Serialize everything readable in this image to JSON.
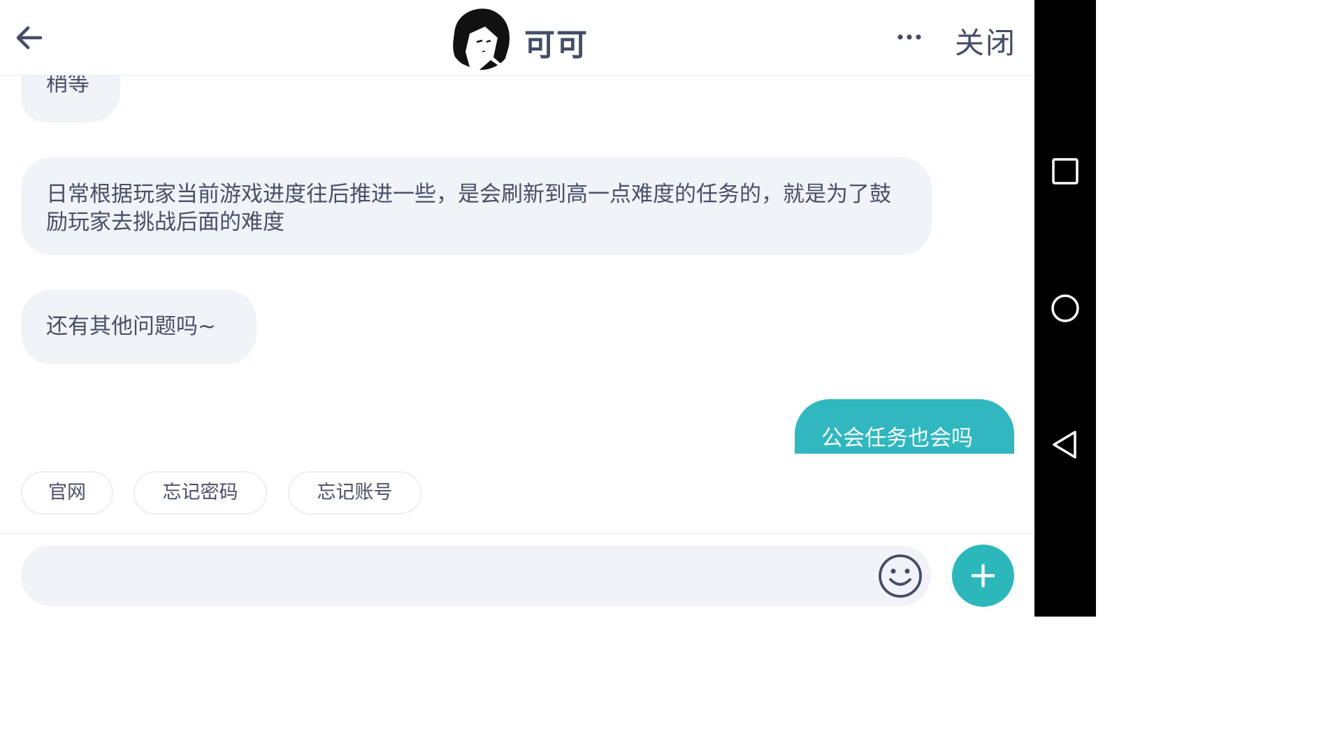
{
  "header": {
    "back_icon": "arrow-left-icon",
    "avatar_label": "anime-girl-avatar",
    "agent_name": "可可",
    "more_icon": "more-horizontal-icon",
    "close_label": "关闭"
  },
  "messages": [
    {
      "from": "agent",
      "text": "稍等"
    },
    {
      "from": "agent",
      "text": "日常根据玩家当前游戏进度往后推进一些，是会刷新到高一点难度的任务的，就是为了鼓励玩家去挑战后面的难度"
    },
    {
      "from": "agent",
      "text": "还有其他问题吗~"
    },
    {
      "from": "user",
      "text": "公会任务也会吗"
    }
  ],
  "quick_replies": [
    "官网",
    "忘记密码",
    "忘记账号"
  ],
  "input": {
    "value": "",
    "placeholder": "",
    "emoji_icon": "smiley-icon",
    "plus_icon": "plus-icon"
  },
  "system_nav": {
    "recents_icon": "square-icon",
    "home_icon": "circle-icon",
    "back_icon": "triangle-back-icon"
  },
  "colors": {
    "accent": "#2cb8bb",
    "user_bubble": "#30b7bf",
    "agent_bubble": "#f0f3f7",
    "text": "#454c66"
  }
}
